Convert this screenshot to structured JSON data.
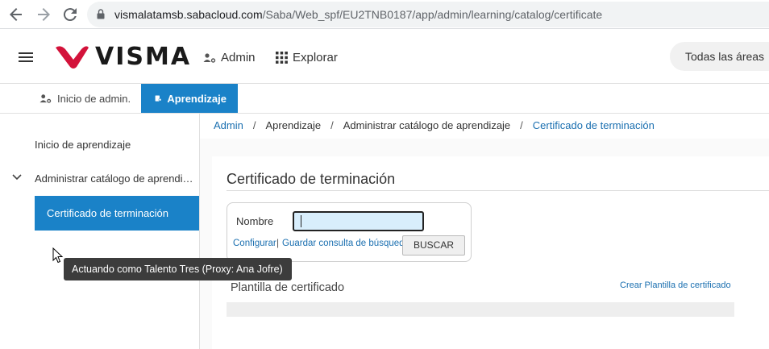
{
  "browser": {
    "url_host": "vismalatamsb.sabacloud.com",
    "url_path": "/Saba/Web_spf/EU2TNB0187/app/admin/learning/catalog/certificate",
    "icons": [
      "back-arrow-icon",
      "forward-arrow-icon",
      "reload-icon",
      "lock-icon"
    ]
  },
  "header": {
    "logo_text": "VISMA",
    "admin_label": "Admin",
    "explore_label": "Explorar",
    "area_label": "Todas las áreas"
  },
  "tabs": {
    "home_label": "Inicio de admin.",
    "learning_label": "Aprendizaje"
  },
  "sidebar": {
    "items": [
      {
        "label": "Inicio de aprendizaje"
      },
      {
        "label": "Administrar catálogo de aprendi…"
      },
      {
        "label": "Certificado de terminación"
      }
    ]
  },
  "tooltip": {
    "text": "Actuando como Talento Tres (Proxy: Ana Jofre)"
  },
  "breadcrumb": {
    "items": [
      "Admin",
      "Aprendizaje",
      "Administrar catálogo de aprendizaje",
      "Certificado de terminación"
    ],
    "separator": "/"
  },
  "main": {
    "title": "Certificado de terminación",
    "search": {
      "name_label": "Nombre",
      "name_value": "",
      "configure_label": "Configurar",
      "pipe": "|",
      "save_query_label": "Guardar consulta de búsqueda",
      "search_button": "BUSCAR"
    },
    "section_title": "Plantilla de certificado",
    "create_link": "Crear Plantilla de certificado"
  },
  "colors": {
    "brand_red": "#d3123a",
    "accent_blue": "#1a82c8",
    "link_blue": "#1a6fb0",
    "input_fill": "#d8eefc"
  }
}
